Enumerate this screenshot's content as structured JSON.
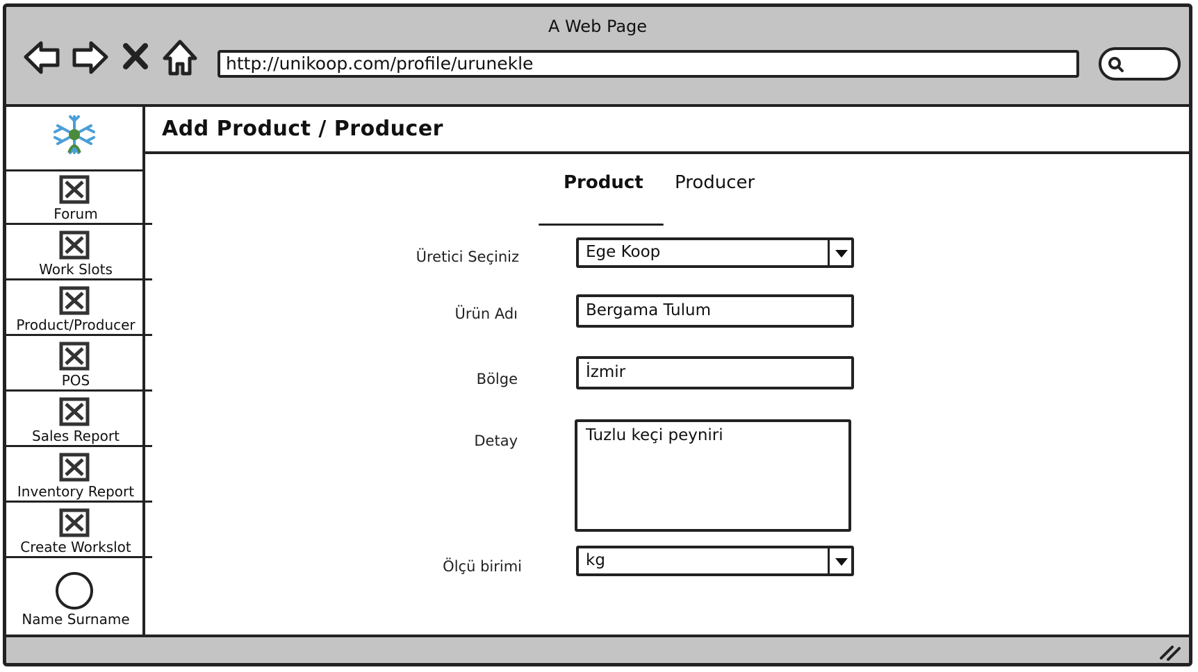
{
  "window": {
    "title": "A Web Page"
  },
  "browser": {
    "url": "http://unikoop.com/profile/urunekle",
    "nav_icons": [
      "back-arrow-icon",
      "forward-arrow-icon",
      "close-x-icon",
      "home-icon"
    ],
    "search_icon": "search-icon"
  },
  "sidebar": {
    "logo_icon": "snowflake-logo-icon",
    "items": [
      {
        "label": "Forum",
        "icon": "placeholder-image-icon"
      },
      {
        "label": "Work Slots",
        "icon": "placeholder-image-icon"
      },
      {
        "label": "Product/Producer",
        "icon": "placeholder-image-icon"
      },
      {
        "label": "POS",
        "icon": "placeholder-image-icon"
      },
      {
        "label": "Sales Report",
        "icon": "placeholder-image-icon"
      },
      {
        "label": "Inventory Report",
        "icon": "placeholder-image-icon"
      },
      {
        "label": "Create Workslot",
        "icon": "placeholder-image-icon"
      }
    ],
    "profile": {
      "name": "Name Surname",
      "icon": "avatar-circle-icon"
    }
  },
  "page": {
    "title": "Add Product / Producer",
    "tabs": [
      {
        "label": "Product",
        "active": true
      },
      {
        "label": "Producer",
        "active": false
      }
    ]
  },
  "form": {
    "producer": {
      "label": "Üretici Seçiniz",
      "value": "Ege Koop"
    },
    "product_name": {
      "label": "Ürün Adı",
      "value": "Bergama Tulum"
    },
    "region": {
      "label": "Bölge",
      "value": "İzmir"
    },
    "detail": {
      "label": "Detay",
      "value": "Tuzlu keçi peyniri"
    },
    "unit": {
      "label": "Ölçü birimi",
      "value": "kg"
    }
  },
  "colors": {
    "chrome": "#c4c4c4",
    "stroke": "#222222",
    "logo_blue": "#4a9fd8",
    "logo_green": "#4a8a3c"
  }
}
